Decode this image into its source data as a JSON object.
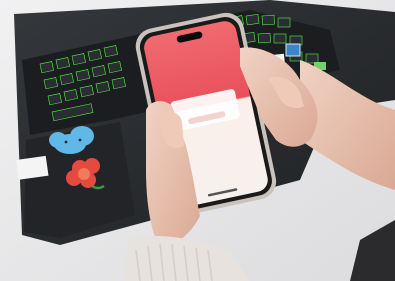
{
  "scene": {
    "subject": "hands-holding-phone-over-laptop",
    "colors": {
      "desk": "#e9e9ea",
      "laptop": "#2a2c2f",
      "keyboard_backlight": "#5cff4a",
      "phone_frame": "#c9c2bd",
      "phone_screen_banner": "#e8505b",
      "phone_screen_body": "#fbefe9",
      "skin": "#e9c4b2",
      "sweater": "#e7e2de",
      "cloud_sticker": "#5fb8e6",
      "flower_sticker": "#e64a3e"
    },
    "phone": {
      "screen_title": "",
      "screen_subtitle": "",
      "popup_button": ""
    }
  }
}
